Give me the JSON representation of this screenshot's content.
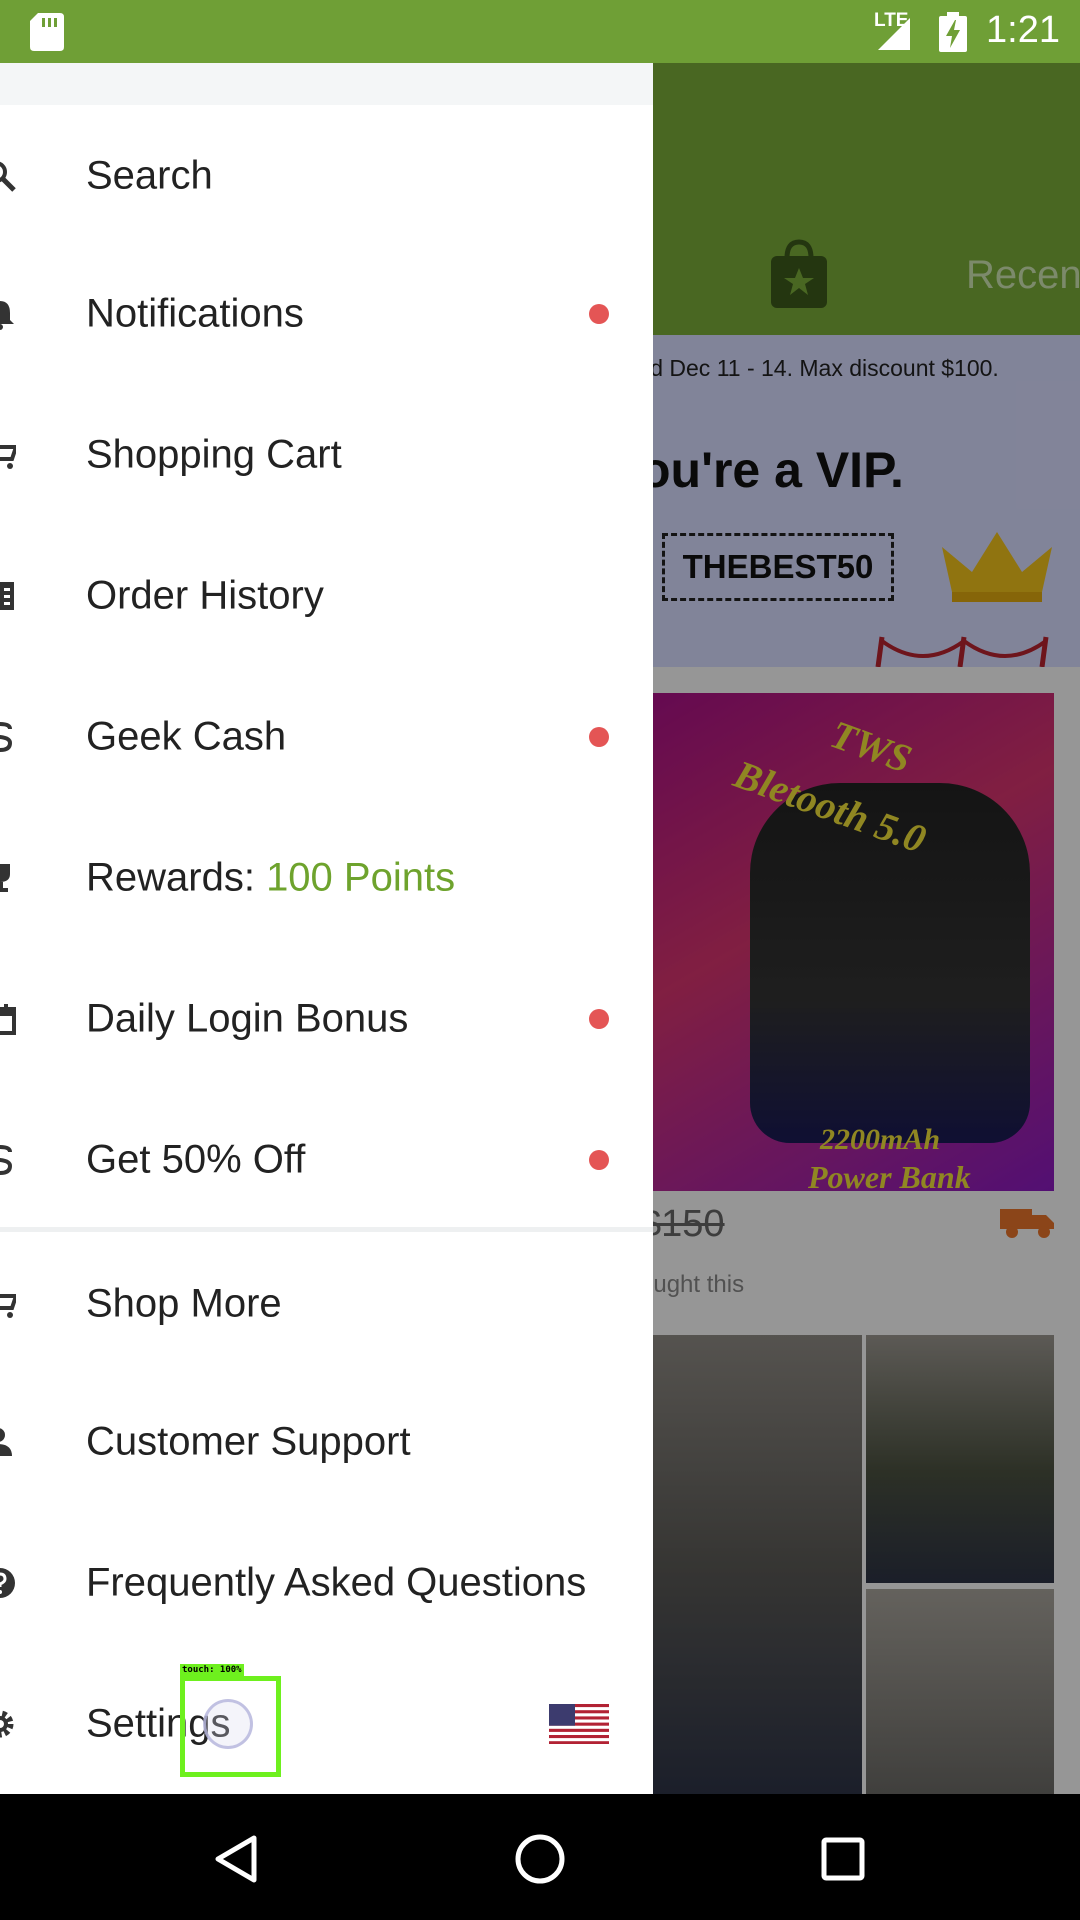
{
  "status_bar": {
    "network": "LTE",
    "time": "1:21",
    "icons": [
      "sd-card-icon",
      "signal-icon",
      "battery-charging-icon"
    ]
  },
  "background_app": {
    "header_tab": "Recen",
    "banner_valid_text": "lid Dec 11 - 14. Max discount $100.",
    "banner_headline": "ou're a VIP.",
    "banner_code": "THEBEST50",
    "product_title_line1": "TWS",
    "product_title_line2": "Bletooth 5.0",
    "product_caption_line1": "2200mAh",
    "product_caption_line2": "Power Bank",
    "product_price": "$150",
    "product_bought_text": "ought this"
  },
  "drawer": {
    "items": [
      {
        "label": "Search",
        "icon": "search-icon",
        "has_dot": false
      },
      {
        "label": "Notifications",
        "icon": "bell-icon",
        "has_dot": true
      },
      {
        "label": "Shopping Cart",
        "icon": "cart-icon",
        "has_dot": false
      },
      {
        "label": "Order History",
        "icon": "receipt-icon",
        "has_dot": false
      },
      {
        "label": "Geek Cash",
        "icon": "dollar-icon",
        "has_dot": true
      },
      {
        "label": "Rewards: ",
        "points": "100 Points",
        "icon": "trophy-icon",
        "has_dot": false
      },
      {
        "label": "Daily Login Bonus",
        "icon": "calendar-icon",
        "has_dot": true
      },
      {
        "label": "Get 50% Off",
        "icon": "dollar-icon",
        "has_dot": true
      },
      {
        "label": "Shop More",
        "icon": "cart-plus-icon",
        "has_dot": false
      },
      {
        "label": "Customer Support",
        "icon": "support-agent-icon",
        "has_dot": false
      },
      {
        "label": "Frequently Asked Questions",
        "icon": "help-icon",
        "has_dot": false
      },
      {
        "label": "Settings",
        "icon": "gear-icon",
        "has_dot": false,
        "flag": "us-flag-icon"
      }
    ]
  },
  "touch_overlay": {
    "label": "touch: 100%"
  },
  "nav_bar": {
    "icons": [
      "back-icon",
      "home-icon",
      "recents-icon"
    ]
  },
  "colors": {
    "status_bar": "#6f9f36",
    "header_green": "#7aac3a",
    "accent_green": "#6ea32d",
    "notification_dot": "#e45555",
    "touch_box": "#6ef01e"
  }
}
